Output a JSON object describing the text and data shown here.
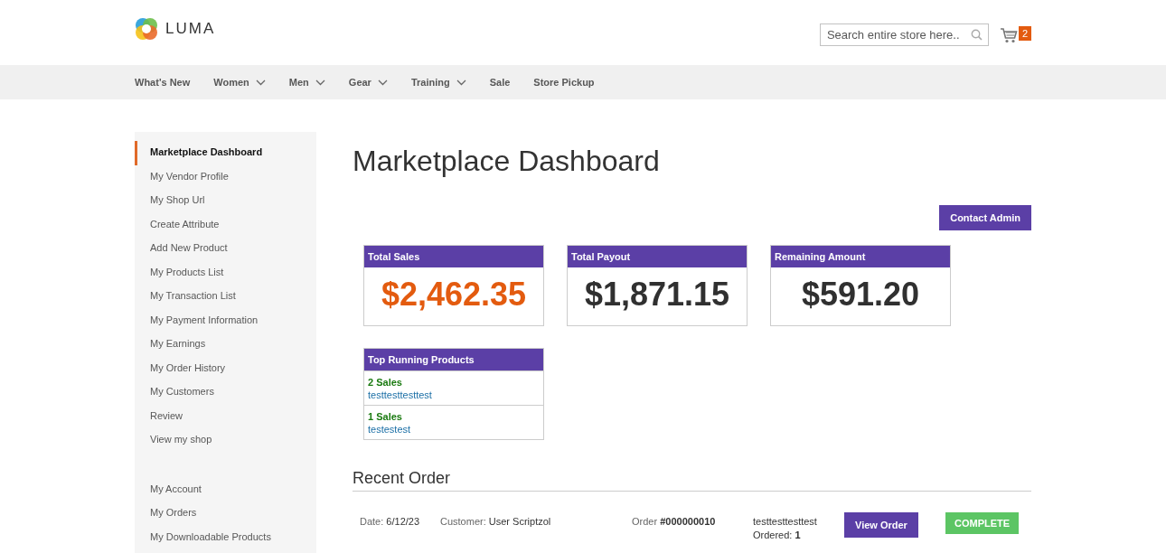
{
  "header": {
    "logo_text": "LUMA",
    "search": {
      "placeholder": "Search entire store here.."
    },
    "cart_count": "2"
  },
  "nav": [
    {
      "label": "What's New",
      "has_dropdown": false
    },
    {
      "label": "Women",
      "has_dropdown": true
    },
    {
      "label": "Men",
      "has_dropdown": true
    },
    {
      "label": "Gear",
      "has_dropdown": true
    },
    {
      "label": "Training",
      "has_dropdown": true
    },
    {
      "label": "Sale",
      "has_dropdown": false
    },
    {
      "label": "Store Pickup",
      "has_dropdown": false
    }
  ],
  "sidebar": {
    "groups": [
      [
        {
          "label": "Marketplace Dashboard",
          "selected": true
        },
        {
          "label": "My Vendor Profile",
          "selected": false
        },
        {
          "label": "My Shop Url",
          "selected": false
        },
        {
          "label": "Create Attribute",
          "selected": false
        },
        {
          "label": "Add New Product",
          "selected": false
        },
        {
          "label": "My Products List",
          "selected": false
        },
        {
          "label": "My Transaction List",
          "selected": false
        },
        {
          "label": "My Payment Information",
          "selected": false
        },
        {
          "label": "My Earnings",
          "selected": false
        },
        {
          "label": "My Order History",
          "selected": false
        },
        {
          "label": "My Customers",
          "selected": false
        },
        {
          "label": "Review",
          "selected": false
        },
        {
          "label": "View my shop",
          "selected": false
        }
      ],
      [
        {
          "label": "My Account",
          "selected": false
        },
        {
          "label": "My Orders",
          "selected": false
        },
        {
          "label": "My Downloadable Products",
          "selected": false
        }
      ]
    ]
  },
  "page_title": "Marketplace Dashboard",
  "contact_button": "Contact Admin",
  "stat_cards": [
    {
      "title": "Total Sales",
      "value": "$2,462.35",
      "highlight": true
    },
    {
      "title": "Total Payout",
      "value": "$1,871.15",
      "highlight": false
    },
    {
      "title": "Remaining Amount",
      "value": "$591.20",
      "highlight": false
    }
  ],
  "top_products": {
    "title": "Top Running Products",
    "items": [
      {
        "sales": "2 Sales",
        "name": "testtesttesttest"
      },
      {
        "sales": "1 Sales",
        "name": "testestest"
      }
    ]
  },
  "recent_order": {
    "title": "Recent Order",
    "orders": [
      {
        "date_label": "Date:",
        "date": "6/12/23",
        "customer_label": "Customer:",
        "customer": "User Scriptzol",
        "order_label": "Order",
        "order_number": "#000000010",
        "product": "testtesttesttest",
        "ordered_label": "Ordered:",
        "ordered": "1",
        "view_button": "View Order",
        "status": "COMPLETE"
      }
    ]
  }
}
